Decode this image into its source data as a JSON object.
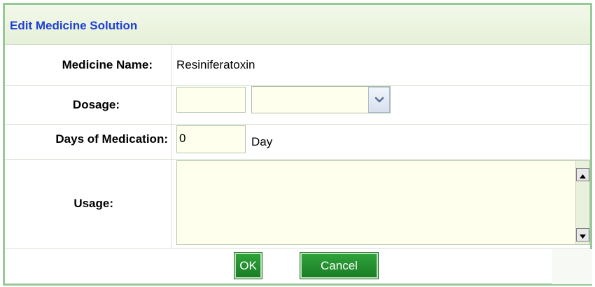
{
  "dialog": {
    "title": "Edit Medicine Solution"
  },
  "form": {
    "medicine_name_label": "Medicine Name:",
    "medicine_name_value": "Resiniferatoxin",
    "dosage_label": "Dosage:",
    "dosage_amount_value": "",
    "dosage_unit_value": "",
    "days_label": "Days of Medication:",
    "days_value": "0",
    "days_unit": "Day",
    "usage_label": "Usage:",
    "usage_value": ""
  },
  "buttons": {
    "ok_label": "OK",
    "cancel_label": "Cancel"
  },
  "colors": {
    "title_text": "#1e3fd6",
    "button_green": "#228b2e",
    "input_background": "#ffffee",
    "border_green": "#98c898"
  },
  "icons": {
    "dropdown": "chevron-down-icon",
    "scroll_up": "triangle-up-icon",
    "scroll_down": "triangle-down-icon"
  }
}
